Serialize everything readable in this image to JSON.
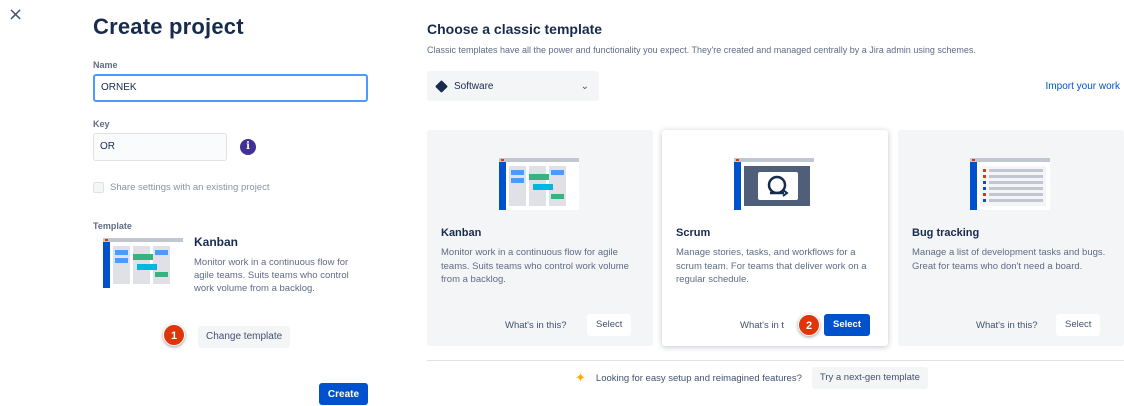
{
  "close_icon": "×",
  "left": {
    "title": "Create project",
    "name_label": "Name",
    "name_value": "ORNEK",
    "key_label": "Key",
    "key_value": "OR",
    "info_icon": "i",
    "share_label": "Share settings with an existing project",
    "template_label": "Template",
    "template_name": "Kanban",
    "template_desc": "Monitor work in a continuous flow for agile teams. Suits teams who control work volume from a backlog.",
    "change_template": "Change template",
    "create": "Create"
  },
  "markers": [
    "1",
    "2"
  ],
  "right": {
    "title": "Choose a classic template",
    "description": "Classic templates have all the power and functionality you expect. They're created and managed centrally by a Jira admin using schemes.",
    "dropdown_value": "Software",
    "import": "Import your work",
    "cards": [
      {
        "title": "Kanban",
        "desc": "Monitor work in a continuous flow for agile teams. Suits teams who control work volume from a backlog.",
        "whats": "What's in this?",
        "select": "Select"
      },
      {
        "title": "Scrum",
        "desc": "Manage stories, tasks, and workflows for a scrum team. For teams that deliver work on a regular schedule.",
        "whats": "What's in t",
        "select": "Select"
      },
      {
        "title": "Bug tracking",
        "desc": "Manage a list of development tasks and bugs. Great for teams who don't need a board.",
        "whats": "What's in this?",
        "select": "Select"
      }
    ],
    "footer_text": "Looking for easy setup and reimagined features?",
    "footer_button": "Try a next-gen template"
  },
  "colors": {
    "primary": "#0052cc",
    "marker": "#de350b",
    "info": "#403294",
    "sparkle": "#ffab00"
  },
  "icons": [
    "close-icon",
    "info-icon",
    "software-diamond-icon",
    "chevron-down-icon",
    "sparkle-icon"
  ]
}
